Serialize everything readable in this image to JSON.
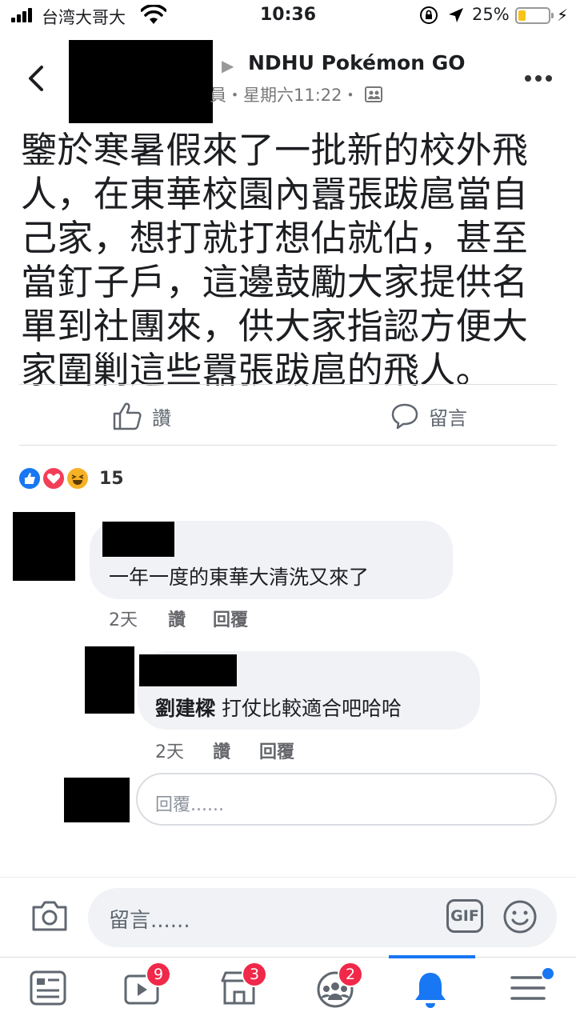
{
  "status_bar": {
    "carrier": "台湾大哥大",
    "time": "10:36",
    "battery_percent": "25%",
    "battery_level": 0.25,
    "battery_color": "#f7c318"
  },
  "post": {
    "group_name": "NDHU Pokémon GO",
    "meta": "員・星期六11:22・",
    "audience_icon": "group-icon",
    "text": "鑒於寒暑假來了一批新的校外飛人，在東華校園內囂張跋扈當自己家，想打就打想佔就佔，甚至當釘子戶，這邊鼓勵大家提供名單到社團來，供大家指認方便大家圍剿這些囂張跋扈的飛人。",
    "like_label": "讚",
    "comment_label": "留言",
    "reaction_count": "15",
    "reactions": [
      "like",
      "love",
      "haha"
    ]
  },
  "comments": [
    {
      "text": "一年一度的東華大清洗又來了",
      "time": "2天",
      "like": "讚",
      "reply": "回覆"
    },
    {
      "mention": "劉建樑",
      "text": " 打仗比較適合吧哈哈",
      "time": "2天",
      "like": "讚",
      "reply": "回覆"
    }
  ],
  "reply_placeholder": "回覆......",
  "composer": {
    "placeholder": "留言......",
    "gif_label": "GIF"
  },
  "tabbar": {
    "watch_badge": "9",
    "marketplace_badge": "3",
    "groups_badge": "2",
    "active_tab": "notifications",
    "accent": "#1877f2",
    "badge_color": "#f02849"
  }
}
